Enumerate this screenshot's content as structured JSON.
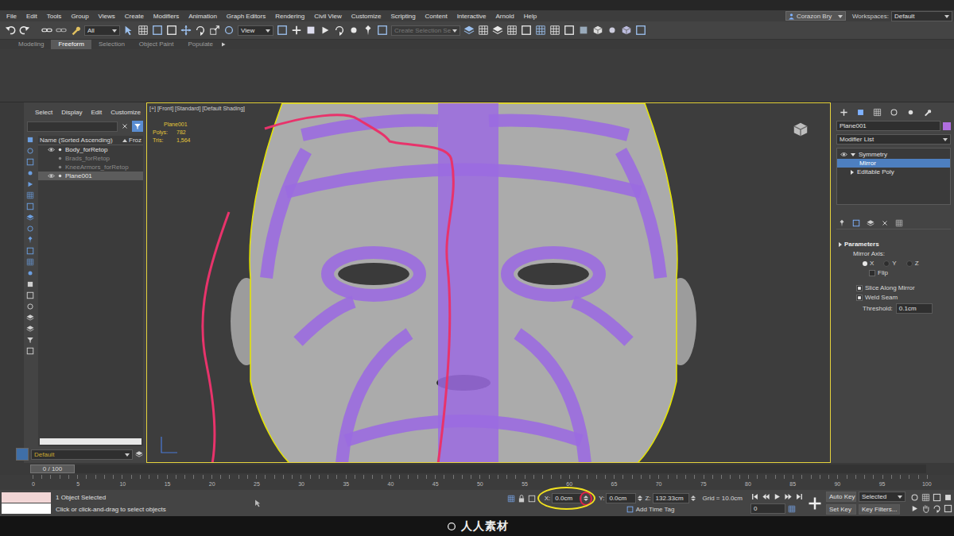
{
  "menu": [
    "File",
    "Edit",
    "Tools",
    "Group",
    "Views",
    "Create",
    "Modifiers",
    "Animation",
    "Graph Editors",
    "Rendering",
    "Civil View",
    "Customize",
    "Scripting",
    "Content",
    "Interactive",
    "Arnold",
    "Help"
  ],
  "user": "Corazon Bry",
  "workspaces": {
    "label": "Workspaces:",
    "value": "Default"
  },
  "toolbar": {
    "filter": "All",
    "view": "View",
    "selection_set": "Create Selection Se"
  },
  "ribbon_tabs": [
    {
      "label": "Modeling",
      "selected": false
    },
    {
      "label": "Freeform",
      "selected": true
    },
    {
      "label": "Selection",
      "selected": false
    },
    {
      "label": "Object Paint",
      "selected": false
    },
    {
      "label": "Populate",
      "selected": false
    }
  ],
  "explorer": {
    "tabs": [
      "Select",
      "Display",
      "Edit",
      "Customize"
    ],
    "column": "Name (Sorted Ascending)",
    "column2": "Froz",
    "items": [
      {
        "name": "Body_forRetop",
        "visible": true,
        "selected": false
      },
      {
        "name": "Brads_forRetop",
        "visible": false,
        "selected": false
      },
      {
        "name": "KneeArmors_forRetop",
        "visible": false,
        "selected": false
      },
      {
        "name": "Plane001",
        "visible": true,
        "selected": true
      }
    ],
    "layer": "Default"
  },
  "viewport": {
    "label": "[+] [Front] [Standard] [Default Shading]",
    "active": true,
    "object": "Plane001",
    "stats": [
      {
        "label": "Polys:",
        "value": "782"
      },
      {
        "label": "Tris:",
        "value": "1,564"
      }
    ]
  },
  "command_panel": {
    "object_name": "Plane001",
    "modifier_list": "Modifier List",
    "stack": [
      {
        "name": "Symmetry",
        "on": true,
        "expanded": true,
        "selected": false,
        "kind": "modifier"
      },
      {
        "name": "Mirror",
        "on": false,
        "expanded": false,
        "selected": true,
        "kind": "sub"
      },
      {
        "name": "Editable Poly",
        "on": false,
        "expanded": false,
        "selected": false,
        "kind": "base"
      }
    ],
    "parameters": {
      "title": "Parameters",
      "axis_label": "Mirror Axis:",
      "axes": [
        {
          "label": "X",
          "selected": true
        },
        {
          "label": "Y",
          "selected": false
        },
        {
          "label": "Z",
          "selected": false
        }
      ],
      "flip": {
        "label": "Flip",
        "checked": false
      },
      "options": [
        {
          "label": "Slice Along Mirror",
          "checked": true
        },
        {
          "label": "Weld Seam",
          "checked": true
        }
      ],
      "threshold": {
        "label": "Threshold:",
        "value": "0.1cm"
      }
    }
  },
  "timeline": {
    "frame": "0 / 100",
    "level": 0,
    "ticks": [
      "0",
      "5",
      "10",
      "15",
      "20",
      "25",
      "30",
      "35",
      "40",
      "45",
      "50",
      "55",
      "60",
      "65",
      "70",
      "75",
      "80",
      "85",
      "90",
      "95",
      "100"
    ]
  },
  "status": {
    "selected": "1 Object Selected",
    "prompt": "Click or click-and-drag to select objects",
    "coords": [
      {
        "axis": "X:",
        "value": "0.0cm"
      },
      {
        "axis": "Y:",
        "value": "0.0cm"
      },
      {
        "axis": "Z:",
        "value": "132.33cm"
      }
    ],
    "grid": "Grid = 10.0cm",
    "time_tag": "Add Time Tag",
    "auto_key": "Auto Key",
    "key_mode": "Selected",
    "set_key": "Set Key",
    "key_filters": "Key Filters...",
    "frame": "0"
  },
  "watermark": "人人素材"
}
